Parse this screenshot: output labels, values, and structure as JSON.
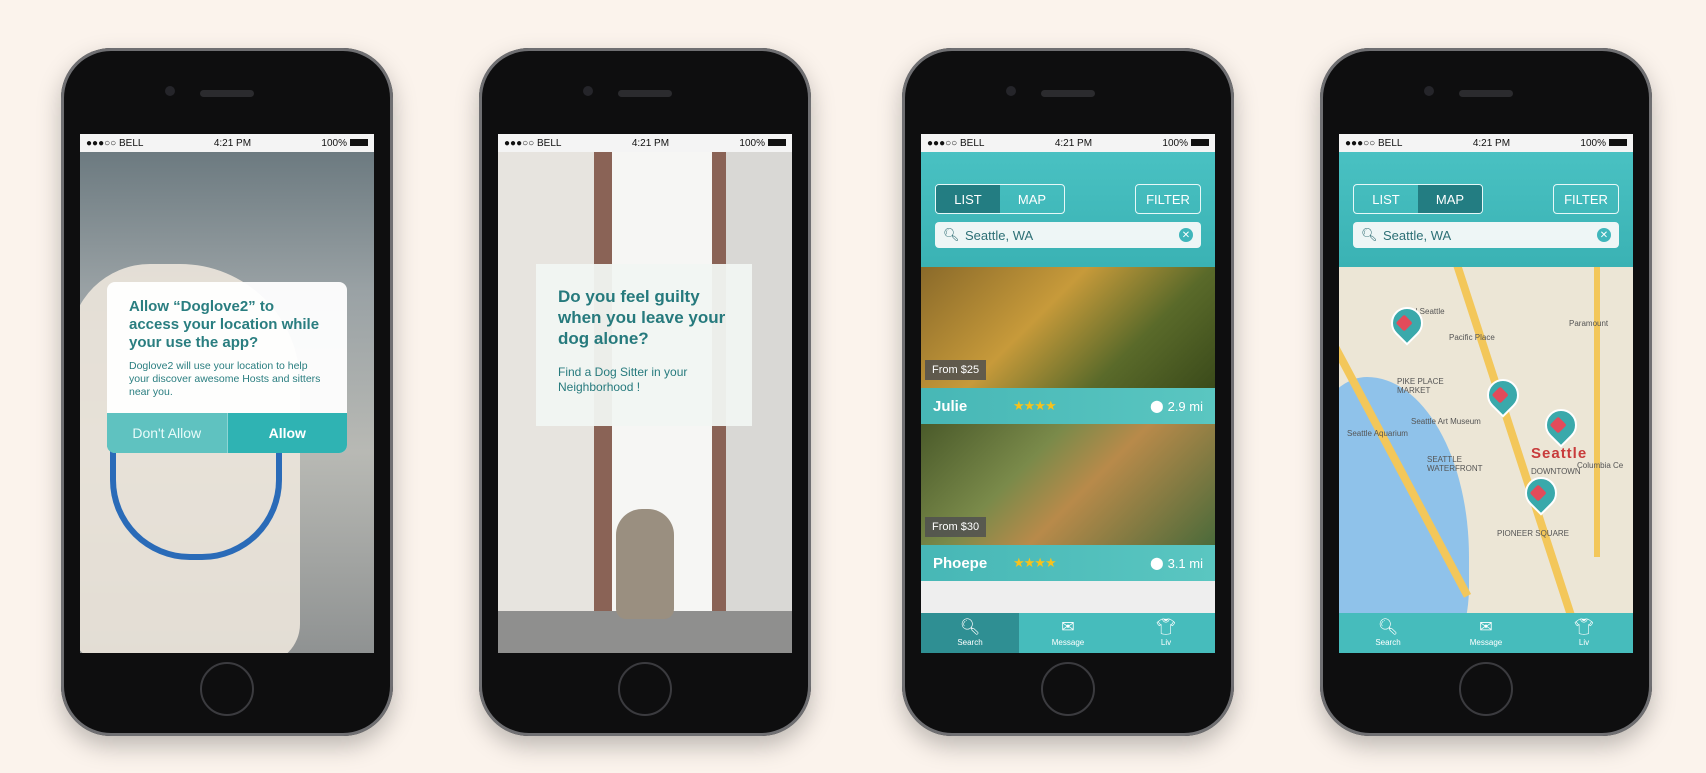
{
  "status": {
    "carrier_short": "●●●○○ BELL",
    "time": "4:21 PM",
    "battery": "100%"
  },
  "screen1": {
    "dialog_title": "Allow “Doglove2” to access your location while your use the app?",
    "dialog_body": "Doglove2 will use your location to help your discover awesome Hosts and sitters near you.",
    "deny_label": "Don't Allow",
    "allow_label": "Allow"
  },
  "screen2": {
    "headline": "Do you feel guilty when you leave your dog alone?",
    "sub": "Find a Dog Sitter in your Neighborhood !"
  },
  "list": {
    "tab_list": "LIST",
    "tab_map": "MAP",
    "filter": "FILTER",
    "search_value": "Seattle, WA",
    "cards": [
      {
        "price": "From $25",
        "name": "Julie",
        "stars": "★★★★",
        "distance": "2.9 mi"
      },
      {
        "price": "From $30",
        "name": "Phoepe",
        "stars": "★★★★",
        "distance": "3.1 mi"
      }
    ]
  },
  "tabs": [
    {
      "icon": "search-icon",
      "label": "Search"
    },
    {
      "icon": "message-icon",
      "label": "Message"
    },
    {
      "icon": "profile-icon",
      "label": "Liv"
    }
  ],
  "map": {
    "labels": {
      "seattle": "Seattle",
      "pike": "PIKE PLACE MARKET",
      "pacific": "Pacific Place",
      "aquarium": "Seattle Aquarium",
      "art": "Seattle Art Museum",
      "waterfront": "SEATTLE WATERFRONT",
      "downtown": "DOWNTOWN",
      "pioneer": "PIONEER SQUARE",
      "paramount": "Paramount",
      "columbia": "Columbia Ce",
      "hotel": "tel Seattle"
    }
  },
  "colors": {
    "teal": "#46bcbc",
    "teal_dark": "#237d82",
    "star": "#f7c21c"
  }
}
